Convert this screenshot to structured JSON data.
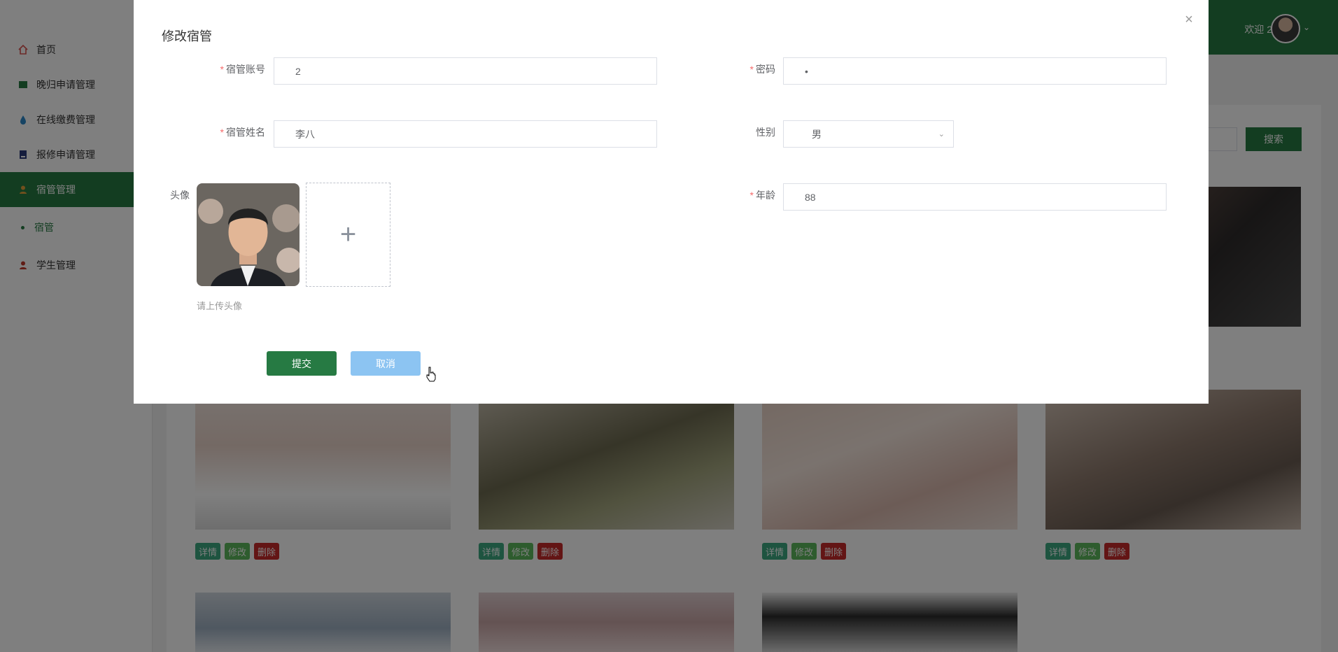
{
  "header": {
    "welcome": "欢迎 2",
    "avatar_icon": "user-avatar",
    "caret_icon": "chevron-down-icon"
  },
  "sidebar": {
    "items": [
      {
        "label": "首页",
        "icon": "home-icon",
        "color": "#d9534f"
      },
      {
        "label": "晚归申请管理",
        "icon": "book-icon",
        "color": "#267a43"
      },
      {
        "label": "在线缴费管理",
        "icon": "drop-icon",
        "color": "#2d89c8"
      },
      {
        "label": "报修申请管理",
        "icon": "document-icon",
        "color": "#2b3a7a"
      },
      {
        "label": "宿管管理",
        "icon": "user-icon",
        "color": "#e5a13a"
      },
      {
        "label": "学生管理",
        "icon": "user-icon",
        "color": "#c0392b"
      }
    ],
    "sub_item": "宿管"
  },
  "main": {
    "search_button": "搜索",
    "card_actions": {
      "detail": "详情",
      "edit": "修改",
      "delete": "删除"
    }
  },
  "modal": {
    "title": "修改宿管",
    "fields": {
      "account": {
        "label": "宿管账号",
        "value": "2",
        "required": true
      },
      "password": {
        "label": "密码",
        "value": "•",
        "required": true
      },
      "name": {
        "label": "宿管姓名",
        "value": "李八",
        "required": true
      },
      "gender": {
        "label": "性别",
        "value": "男",
        "required": false
      },
      "avatar": {
        "label": "头像",
        "hint": "请上传头像",
        "required": false
      },
      "age": {
        "label": "年龄",
        "value": "88",
        "required": true
      }
    },
    "submit_label": "提交",
    "cancel_label": "取消"
  },
  "colors": {
    "primary": "#267a43",
    "danger": "#c62a2a",
    "cancel": "#8cc4f2"
  }
}
